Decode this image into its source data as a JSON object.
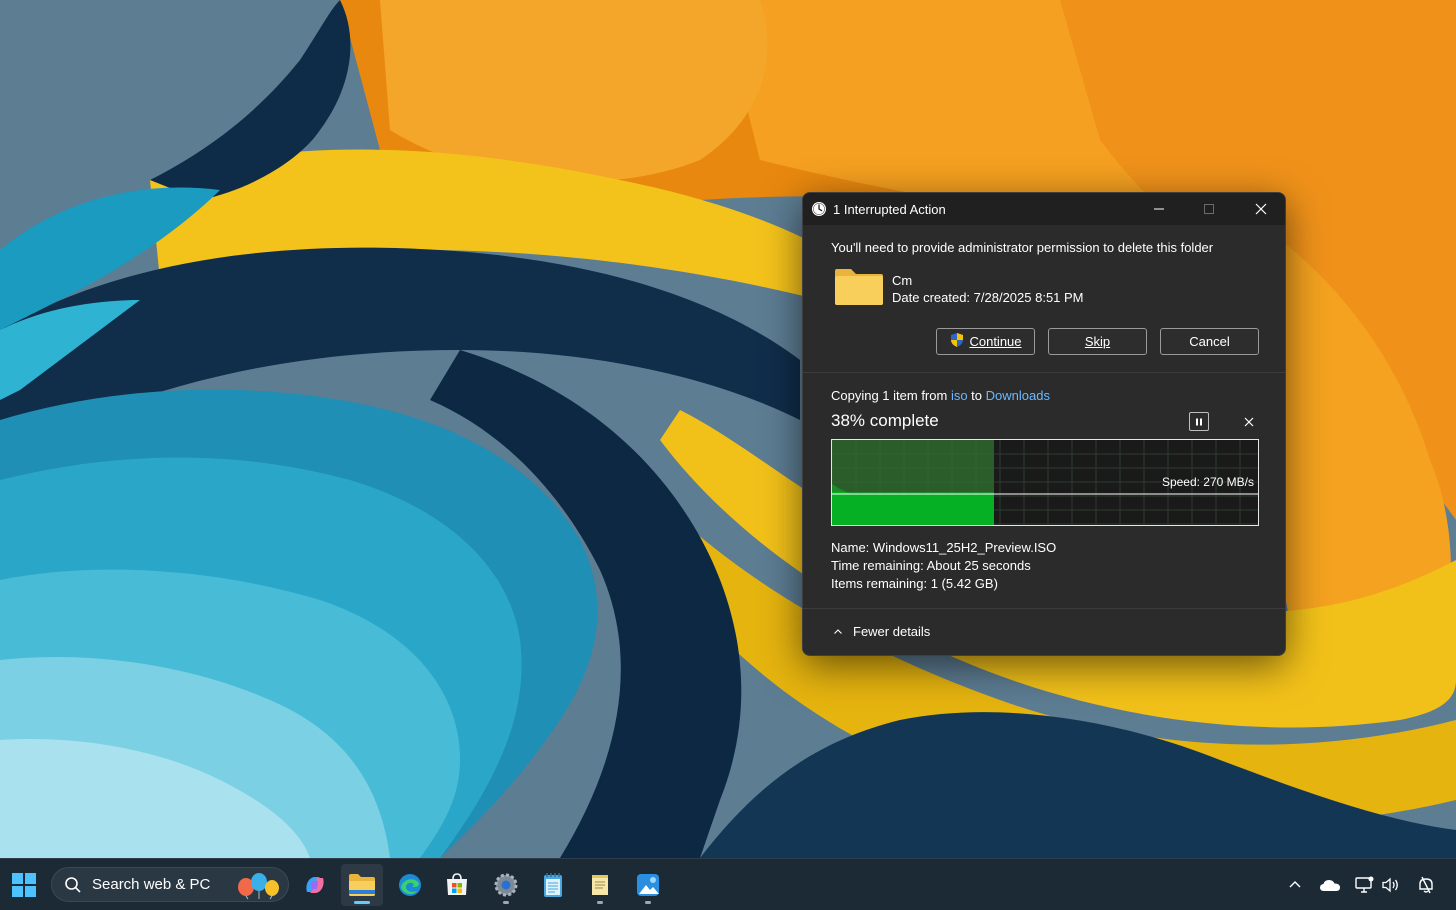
{
  "dialog": {
    "title": "1 Interrupted Action",
    "permission_message": "You'll need to provide administrator permission to delete this folder",
    "folder": {
      "name": "Cm",
      "date_created": "Date created: 7/28/2025 8:51 PM"
    },
    "buttons": {
      "continue": "Continue",
      "skip": "Skip",
      "cancel": "Cancel"
    },
    "progress": {
      "prefix": "Copying 1 item from ",
      "source": "iso",
      "middle": " to ",
      "destination": "Downloads",
      "percent_text": "38% complete",
      "percent": 38,
      "speed": "Speed: 270 MB/s"
    },
    "details": {
      "name_label": "Name:",
      "name_value": "Windows11_25H2_Preview.ISO",
      "time_label": "Time remaining:",
      "time_value": "About 25 seconds",
      "items_label": "Items remaining:",
      "items_value": "1 (5.42 GB)"
    },
    "fewer_details": "Fewer details"
  },
  "taskbar": {
    "search_placeholder": "Search web & PC",
    "pinned": [
      "start-icon",
      "copilot-icon",
      "file-explorer-icon",
      "edge-icon",
      "microsoft-store-icon",
      "settings-icon",
      "notepad-icon",
      "notes-icon",
      "photos-icon"
    ],
    "tray": [
      "chevron-up-icon",
      "onedrive-icon",
      "network-icon",
      "volume-icon",
      "notification-icon"
    ]
  },
  "colors": {
    "dialog_bg": "#2b2b2b",
    "titlebar_bg": "#202020",
    "progress_green": "#06b025",
    "link_blue": "#6cb8ff",
    "taskbar_bg": "#1c2a36",
    "folder_yellow": "#f8cf5a"
  }
}
